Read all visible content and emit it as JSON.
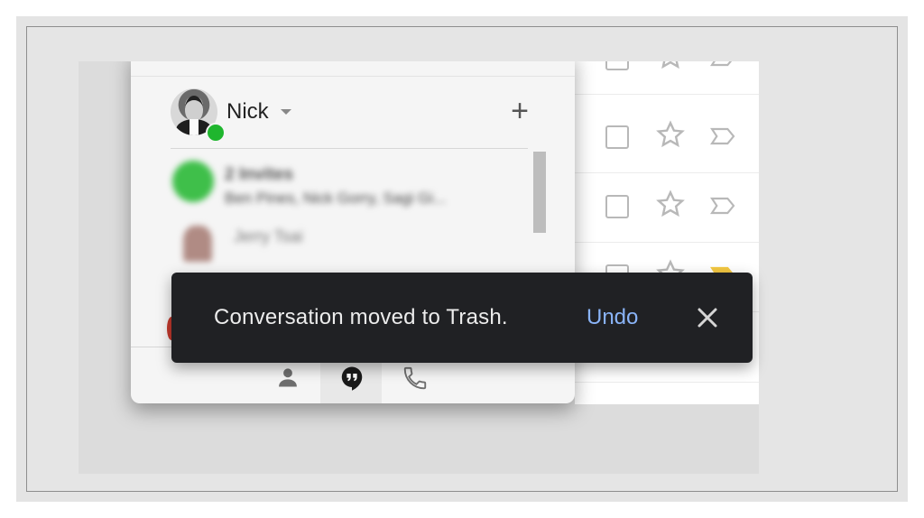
{
  "user": {
    "name": "Nick"
  },
  "conversations": [
    {
      "title": "2 Invites",
      "subtitle": "Ben Pines, Nick Gorry, Sagi Gi..."
    },
    {
      "title": "Jerry Tsai"
    }
  ],
  "snackbar": {
    "message": "Conversation moved to Trash.",
    "action_label": "Undo"
  },
  "icons": {
    "add": "plus-icon",
    "people_tab": "person-icon",
    "chat_tab": "hangouts-quote-icon",
    "phone_tab": "phone-icon",
    "close": "close-icon",
    "star": "star-icon",
    "label": "label-tag-icon"
  },
  "colors": {
    "snackbar_bg": "#202124",
    "undo_link": "#8ab4f8",
    "online_status": "#1fb62e"
  }
}
